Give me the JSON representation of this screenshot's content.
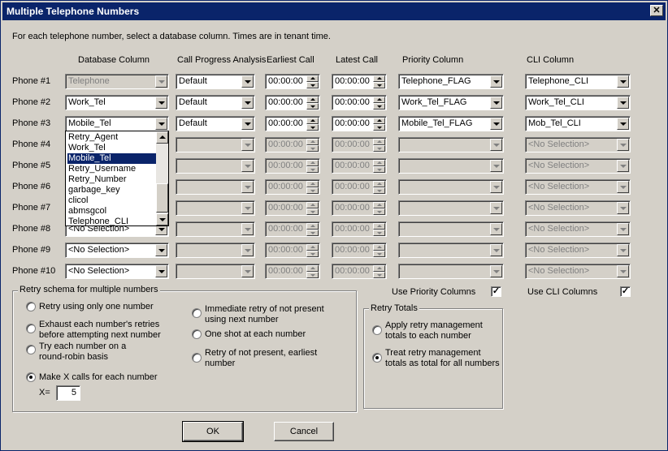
{
  "window": {
    "title": "Multiple Telephone Numbers",
    "close_label": "✕"
  },
  "instructions": "For each telephone number, select a database column.  Times are in tenant time.",
  "headers": {
    "database_column": "Database Column",
    "call_progress": "Call Progress Analysis",
    "earliest_call": "Earliest Call",
    "latest_call": "Latest Call",
    "priority_column": "Priority Column",
    "cli_column": "CLI Column"
  },
  "rows": [
    {
      "label": "Phone #1",
      "db": "Telephone",
      "cpa": "Default",
      "earliest": "00:00:00",
      "latest": "00:00:00",
      "priority": "Telephone_FLAG",
      "cli": "Telephone_CLI"
    },
    {
      "label": "Phone #2",
      "db": "Work_Tel",
      "cpa": "Default",
      "earliest": "00:00:00",
      "latest": "00:00:00",
      "priority": "Work_Tel_FLAG",
      "cli": "Work_Tel_CLI"
    },
    {
      "label": "Phone #3",
      "db": "Mobile_Tel",
      "cpa": "Default",
      "earliest": "00:00:00",
      "latest": "00:00:00",
      "priority": "Mobile_Tel_FLAG",
      "cli": "Mob_Tel_CLI"
    },
    {
      "label": "Phone #4",
      "db": "",
      "cpa": "",
      "earliest": "00:00:00",
      "latest": "00:00:00",
      "priority": "",
      "cli": "<No Selection>"
    },
    {
      "label": "Phone #5",
      "db": "",
      "cpa": "",
      "earliest": "00:00:00",
      "latest": "00:00:00",
      "priority": "",
      "cli": "<No Selection>"
    },
    {
      "label": "Phone #6",
      "db": "",
      "cpa": "",
      "earliest": "00:00:00",
      "latest": "00:00:00",
      "priority": "",
      "cli": "<No Selection>"
    },
    {
      "label": "Phone #7",
      "db": "",
      "cpa": "",
      "earliest": "00:00:00",
      "latest": "00:00:00",
      "priority": "",
      "cli": "<No Selection>"
    },
    {
      "label": "Phone #8",
      "db": "<No Selection>",
      "cpa": "",
      "earliest": "00:00:00",
      "latest": "00:00:00",
      "priority": "",
      "cli": "<No Selection>"
    },
    {
      "label": "Phone #9",
      "db": "<No Selection>",
      "cpa": "",
      "earliest": "00:00:00",
      "latest": "00:00:00",
      "priority": "",
      "cli": "<No Selection>"
    },
    {
      "label": "Phone #10",
      "db": "<No Selection>",
      "cpa": "",
      "earliest": "00:00:00",
      "latest": "00:00:00",
      "priority": "",
      "cli": "<No Selection>"
    }
  ],
  "dropdown_list": {
    "items": [
      "Retry_Agent",
      "Work_Tel",
      "Mobile_Tel",
      "Retry_Username",
      "Retry_Number",
      "garbage_key",
      "clicol",
      "abmsgcol",
      "Telephone_CLI"
    ],
    "selected": "Mobile_Tel"
  },
  "retry_schema": {
    "title": "Retry schema for multiple numbers",
    "options_left": [
      "Retry using only one number",
      "Exhaust each number's retries",
      "before attempting next number",
      "Try each number on a",
      "round-robin basis",
      "Make X calls for each number"
    ],
    "options_right": [
      "Immediate retry of not present",
      "using next number",
      "One shot at each number",
      "Retry of not present, earliest",
      "number"
    ],
    "x_label": "X=",
    "x_value": "5",
    "selected": "Make X calls for each number"
  },
  "use_priority": {
    "label": "Use Priority Columns",
    "checked": true
  },
  "use_cli": {
    "label": "Use CLI Columns",
    "checked": true
  },
  "retry_totals": {
    "title": "Retry Totals",
    "opt1_l1": "Apply retry management",
    "opt1_l2": "totals to each number",
    "opt2_l1": "Treat retry management",
    "opt2_l2": "totals as total for all numbers",
    "selected": "opt2"
  },
  "buttons": {
    "ok": "OK",
    "cancel": "Cancel"
  },
  "check_mark": "✓"
}
